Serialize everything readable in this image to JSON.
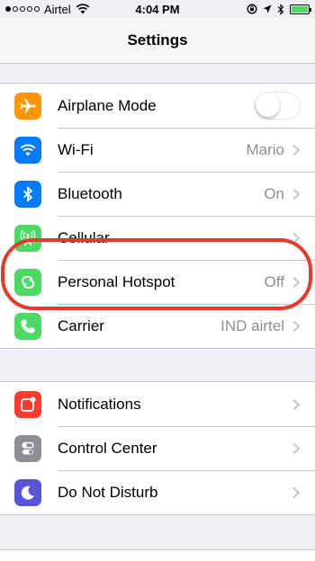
{
  "status_bar": {
    "carrier": "Airtel",
    "time": "4:04 PM",
    "battery_level": 1.0
  },
  "nav": {
    "title": "Settings"
  },
  "group1": {
    "items": [
      {
        "label": "Airplane Mode",
        "icon": "airplane-icon",
        "icon_color": "#ff9500",
        "toggle": false
      },
      {
        "label": "Wi-Fi",
        "value": "Mario",
        "icon": "wifi-icon",
        "icon_color": "#007aff"
      },
      {
        "label": "Bluetooth",
        "value": "On",
        "icon": "bluetooth-icon",
        "icon_color": "#007aff"
      },
      {
        "label": "Cellular",
        "icon": "cellular-icon",
        "icon_color": "#4cd964"
      },
      {
        "label": "Personal Hotspot",
        "value": "Off",
        "icon": "hotspot-icon",
        "icon_color": "#4cd964"
      },
      {
        "label": "Carrier",
        "value": "IND airtel",
        "icon": "phone-icon",
        "icon_color": "#4cd964"
      }
    ]
  },
  "group2": {
    "items": [
      {
        "label": "Notifications",
        "icon": "notifications-icon",
        "icon_color": "#ff3b30"
      },
      {
        "label": "Control Center",
        "icon": "control-center-icon",
        "icon_color": "#8e8e93"
      },
      {
        "label": "Do Not Disturb",
        "icon": "moon-icon",
        "icon_color": "#5856d6"
      }
    ]
  },
  "annotation": {
    "highlight_color": "#e53a2b"
  }
}
